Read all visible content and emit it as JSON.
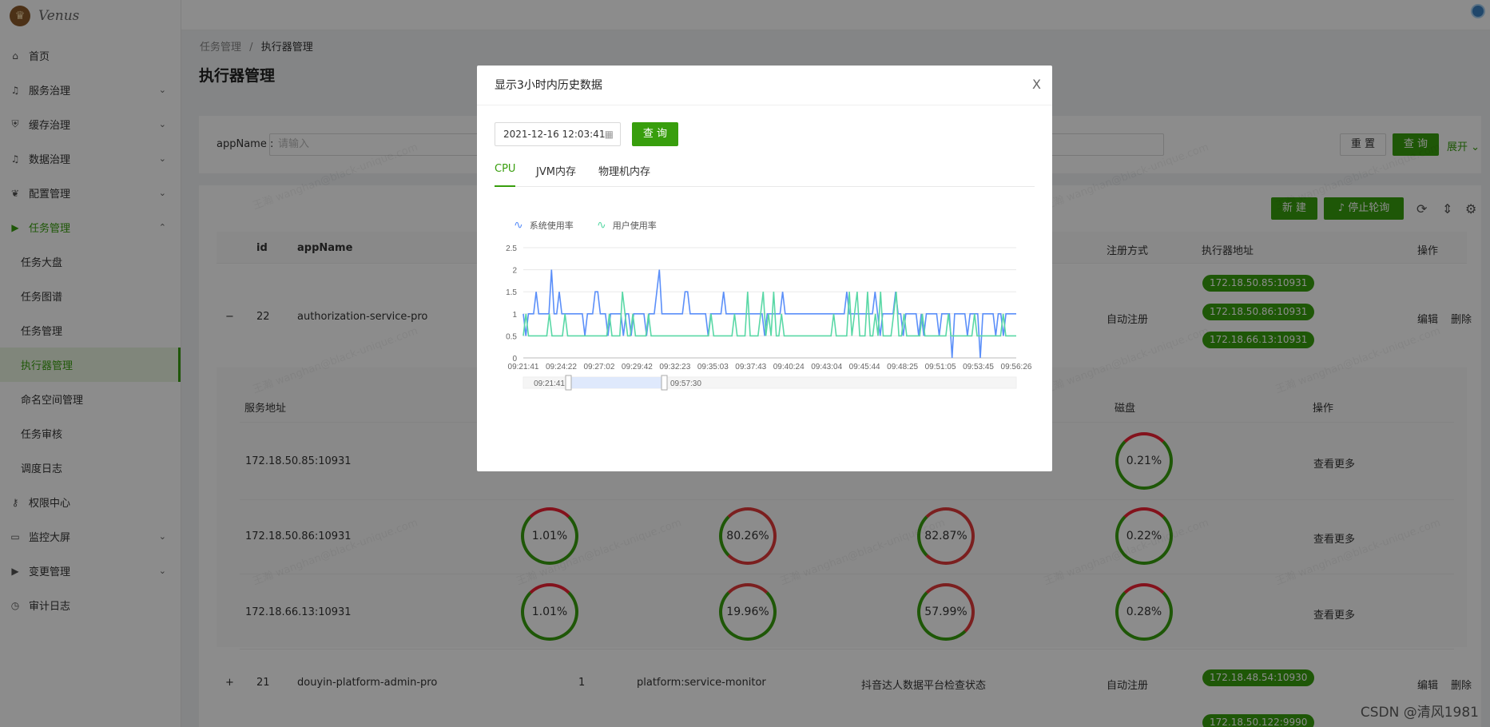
{
  "brand": {
    "name": "Venus"
  },
  "topbar": {
    "avatar": "user-avatar"
  },
  "sidebar": {
    "items": [
      {
        "label": "首页",
        "icon": "home-icon",
        "chev": ""
      },
      {
        "label": "服务治理",
        "icon": "bell-icon",
        "chev": "⌄"
      },
      {
        "label": "缓存治理",
        "icon": "shield-icon",
        "chev": "⌄"
      },
      {
        "label": "数据治理",
        "icon": "bell-icon",
        "chev": "⌄"
      },
      {
        "label": "配置管理",
        "icon": "apple-icon",
        "chev": "⌄"
      },
      {
        "label": "任务管理",
        "icon": "play-icon",
        "chev": "⌃"
      }
    ],
    "sub_items": [
      "任务大盘",
      "任务图谱",
      "任务管理",
      "执行器管理",
      "命名空间管理",
      "任务审核",
      "调度日志"
    ],
    "items_after": [
      {
        "label": "权限中心",
        "icon": "key-icon",
        "chev": ""
      },
      {
        "label": "监控大屏",
        "icon": "laptop-icon",
        "chev": "⌄"
      },
      {
        "label": "变更管理",
        "icon": "play-icon",
        "chev": "⌄"
      },
      {
        "label": "审计日志",
        "icon": "clock-icon",
        "chev": ""
      }
    ]
  },
  "breadcrumb": {
    "parent": "任务管理",
    "sep": "/",
    "current": "执行器管理"
  },
  "page_title": "执行器管理",
  "search": {
    "label": "appName :",
    "placeholder": "请输入",
    "reset": "重 置",
    "query": "查 询",
    "expand": "展开 ⌄"
  },
  "toolbar": {
    "new": "新 建",
    "stop_poll": "♪ 停止轮询"
  },
  "table": {
    "headers": {
      "id": "id",
      "appName": "appName",
      "register": "注册方式",
      "address": "执行器地址",
      "ops": "操作"
    },
    "row22": {
      "toggle": "−",
      "id": "22",
      "appName": "authorization-service-pro",
      "register": "自动注册",
      "addresses": [
        "172.18.50.85:10931",
        "172.18.50.86:10931",
        "172.18.66.13:10931"
      ],
      "edit": "编辑",
      "delete": "删除"
    },
    "sub": {
      "headers": {
        "addr": "服务地址",
        "disk": "磁盘",
        "ops": "操作"
      },
      "rows": [
        {
          "addr": "172.18.50.85:10931",
          "disk": "0.21%",
          "more": "查看更多"
        },
        {
          "addr": "172.18.50.86:10931",
          "cpu": "1.01%",
          "jvm": "80.26%",
          "phys": "82.87%",
          "disk": "0.22%",
          "more": "查看更多"
        },
        {
          "addr": "172.18.66.13:10931",
          "cpu": "1.01%",
          "jvm": "19.96%",
          "phys": "57.99%",
          "disk": "0.28%",
          "more": "查看更多"
        }
      ]
    },
    "row21": {
      "toggle": "+",
      "id": "21",
      "appName": "douyin-platform-admin-pro",
      "count": "1",
      "group": "platform:service-monitor",
      "desc": "抖音达人数据平台检查状态",
      "register": "自动注册",
      "address": "172.18.48.54:10930",
      "edit": "编辑",
      "delete": "删除"
    },
    "row20": {
      "address": "172.18.50.122:9990"
    }
  },
  "modal": {
    "title": "显示3小时内历史数据",
    "close": "X",
    "date": "2021-12-16 12:03:41",
    "query": "查 询",
    "tabs": [
      "CPU",
      "JVM内存",
      "物理机内存"
    ]
  },
  "watermark": "王瀚 wanghan@black-unique.com",
  "footer": "CSDN @清风1981",
  "chart_data": {
    "type": "line",
    "series": [
      {
        "name": "系统使用率",
        "color": "#5b8ff9",
        "values": [
          1,
          0.5,
          1,
          1,
          1,
          1.5,
          1,
          1,
          1,
          1,
          1,
          2,
          1,
          1,
          1.5,
          1,
          1,
          1,
          1,
          1,
          1,
          1,
          1,
          1,
          0.5,
          1,
          1,
          1,
          1.5,
          1.5,
          1,
          1,
          1,
          0.5,
          1,
          1,
          1,
          1,
          1,
          0.5,
          1,
          1,
          0.5,
          1,
          1,
          1,
          1,
          1,
          0.5,
          1,
          1,
          1,
          1.5,
          2,
          1,
          1,
          1,
          1,
          1,
          1,
          1,
          1,
          1,
          1.5,
          1.5,
          1,
          1,
          1,
          1,
          1,
          1,
          1,
          0.5,
          1,
          1,
          1,
          1,
          1,
          1.5,
          1,
          1,
          1,
          1,
          1,
          1,
          1,
          1,
          1,
          1,
          1,
          1,
          1,
          1,
          1,
          0.5,
          1,
          1,
          1,
          1,
          1,
          1,
          1.5,
          1,
          1,
          1,
          1,
          1,
          1,
          1,
          1,
          1,
          1,
          1,
          1,
          1,
          1,
          1,
          1,
          1,
          1,
          1,
          1,
          1,
          1,
          1,
          1,
          1.5,
          1,
          1,
          1,
          1,
          1,
          1,
          1,
          1,
          1,
          1,
          1.5,
          1,
          0.5,
          1,
          1,
          1,
          1,
          1,
          1.5,
          1,
          1,
          0.5,
          1,
          1,
          1,
          1,
          1,
          0.5,
          1,
          0.5,
          1,
          1,
          1,
          1,
          1,
          0.5,
          1,
          1,
          1,
          1,
          0,
          1,
          1,
          1,
          1,
          1,
          0.5,
          1,
          1,
          1,
          1,
          0,
          1,
          1,
          1,
          1,
          1,
          0.5,
          1,
          1,
          0.5,
          1,
          1,
          1,
          1,
          1
        ]
      },
      {
        "name": "用户使用率",
        "color": "#5ad8a6",
        "values": [
          0.5,
          1,
          0.5,
          0.5,
          0.5,
          0.5,
          0.5,
          0.5,
          0.5,
          0.5,
          1,
          0.5,
          0.5,
          0.5,
          0.5,
          0.5,
          1,
          0.5,
          0.5,
          0.5,
          0.5,
          0.5,
          0.5,
          0.5,
          0.5,
          0.5,
          0.5,
          0.5,
          0.5,
          0.5,
          0.5,
          0.5,
          0.5,
          1,
          0.5,
          0.5,
          0.5,
          0.5,
          1.5,
          1,
          0.5,
          0.5,
          1,
          0.5,
          0.5,
          0.5,
          0.5,
          0.5,
          1,
          0.5,
          0.5,
          0.5,
          0.5,
          0.5,
          0.5,
          0.5,
          0.5,
          0.5,
          0.5,
          0.5,
          0.5,
          0.5,
          0.5,
          0.5,
          0.5,
          0.5,
          0.5,
          0.5,
          0.5,
          0.5,
          0.5,
          0.5,
          1,
          0.5,
          0.5,
          0.5,
          0.5,
          0.5,
          0.5,
          0.5,
          0.5,
          1,
          0.5,
          0.5,
          0.5,
          0.5,
          1.5,
          0.5,
          0.5,
          0.5,
          0.5,
          1,
          1.5,
          0.5,
          1,
          0.5,
          1.5,
          0.5,
          0.5,
          1,
          0.5,
          0.5,
          0.5,
          0.5,
          0.5,
          0.5,
          0.5,
          0.5,
          0.5,
          0.5,
          0.5,
          0.5,
          0.5,
          0.5,
          0.5,
          0.5,
          0.5,
          0.5,
          0.5,
          1,
          0.5,
          0.5,
          0.5,
          0.5,
          0.5,
          1.5,
          0.5,
          1,
          1.5,
          0.5,
          0.5,
          0.5,
          1.5,
          0.5,
          0.5,
          1,
          0.5,
          1.5,
          0.5,
          0.5,
          0.5,
          0.5,
          1,
          1.5,
          0.5,
          0.5,
          1,
          0.5,
          0.5,
          0.5,
          0.5,
          0.5,
          0.5,
          1,
          0.5,
          0.5,
          0.5,
          0.5,
          0.5,
          0.5,
          0.5,
          0.5,
          0.5,
          1,
          0.5,
          0.5,
          0.5,
          0.5,
          0.5,
          0.5,
          0.5,
          0.5,
          0.5,
          1,
          0.5,
          0.5,
          0.5,
          0.5,
          0.5,
          0.5,
          0.5,
          0.5,
          0.5,
          0.5,
          1,
          0.5,
          0.5,
          0.5,
          0.5,
          0.5
        ]
      }
    ],
    "x_ticks": [
      "09:21:41",
      "09:24:22",
      "09:27:02",
      "09:29:42",
      "09:32:23",
      "09:35:03",
      "09:37:43",
      "09:40:24",
      "09:43:04",
      "09:45:44",
      "09:48:25",
      "09:51:05",
      "09:53:45",
      "09:56:26"
    ],
    "ylim": [
      0,
      2.5
    ],
    "y_ticks": [
      "0",
      "0.5",
      "1",
      "1.5",
      "2",
      "2.5"
    ],
    "grid": true,
    "legend": "top-left",
    "zoom_slider": {
      "start": "09:21:41",
      "end": "09:57:30"
    }
  }
}
